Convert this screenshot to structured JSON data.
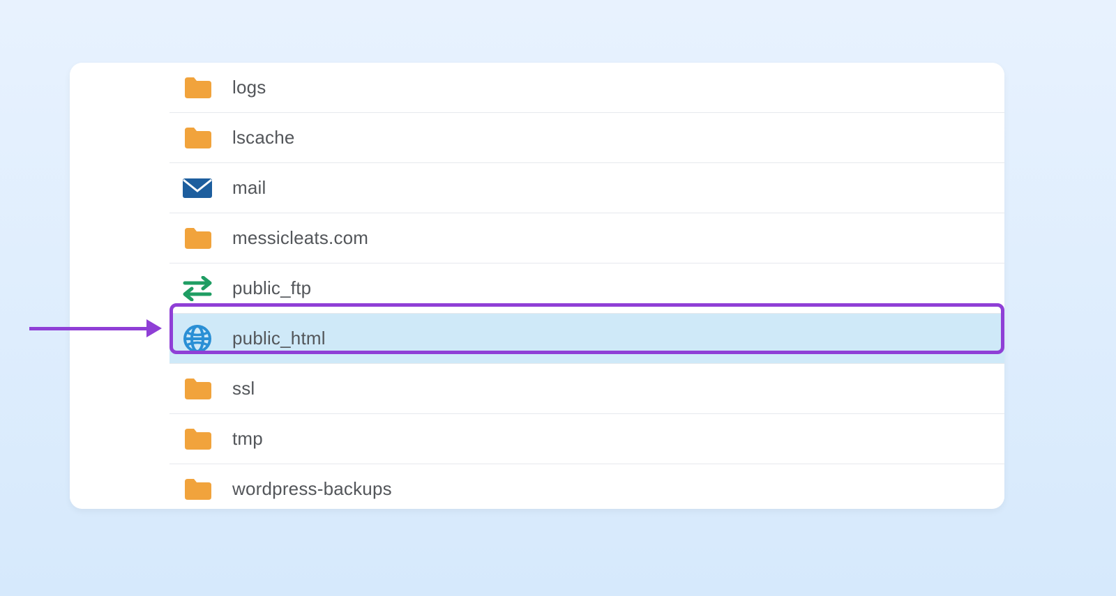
{
  "colors": {
    "folder": "#f1a33c",
    "mail": "#1d5e9e",
    "ftp": "#1f9d63",
    "globe": "#2a8fd5",
    "highlight": "#8f3fd6",
    "selectedBg": "#cfe9f8"
  },
  "annotation": {
    "highlightedItem": "public_html"
  },
  "fileList": {
    "items": [
      {
        "name": "logs",
        "icon": "folder",
        "selected": false
      },
      {
        "name": "lscache",
        "icon": "folder",
        "selected": false
      },
      {
        "name": "mail",
        "icon": "mail",
        "selected": false
      },
      {
        "name": "messicleats.com",
        "icon": "folder",
        "selected": false
      },
      {
        "name": "public_ftp",
        "icon": "ftp",
        "selected": false
      },
      {
        "name": "public_html",
        "icon": "globe",
        "selected": true
      },
      {
        "name": "ssl",
        "icon": "folder",
        "selected": false
      },
      {
        "name": "tmp",
        "icon": "folder",
        "selected": false
      },
      {
        "name": "wordpress-backups",
        "icon": "folder",
        "selected": false
      }
    ]
  }
}
